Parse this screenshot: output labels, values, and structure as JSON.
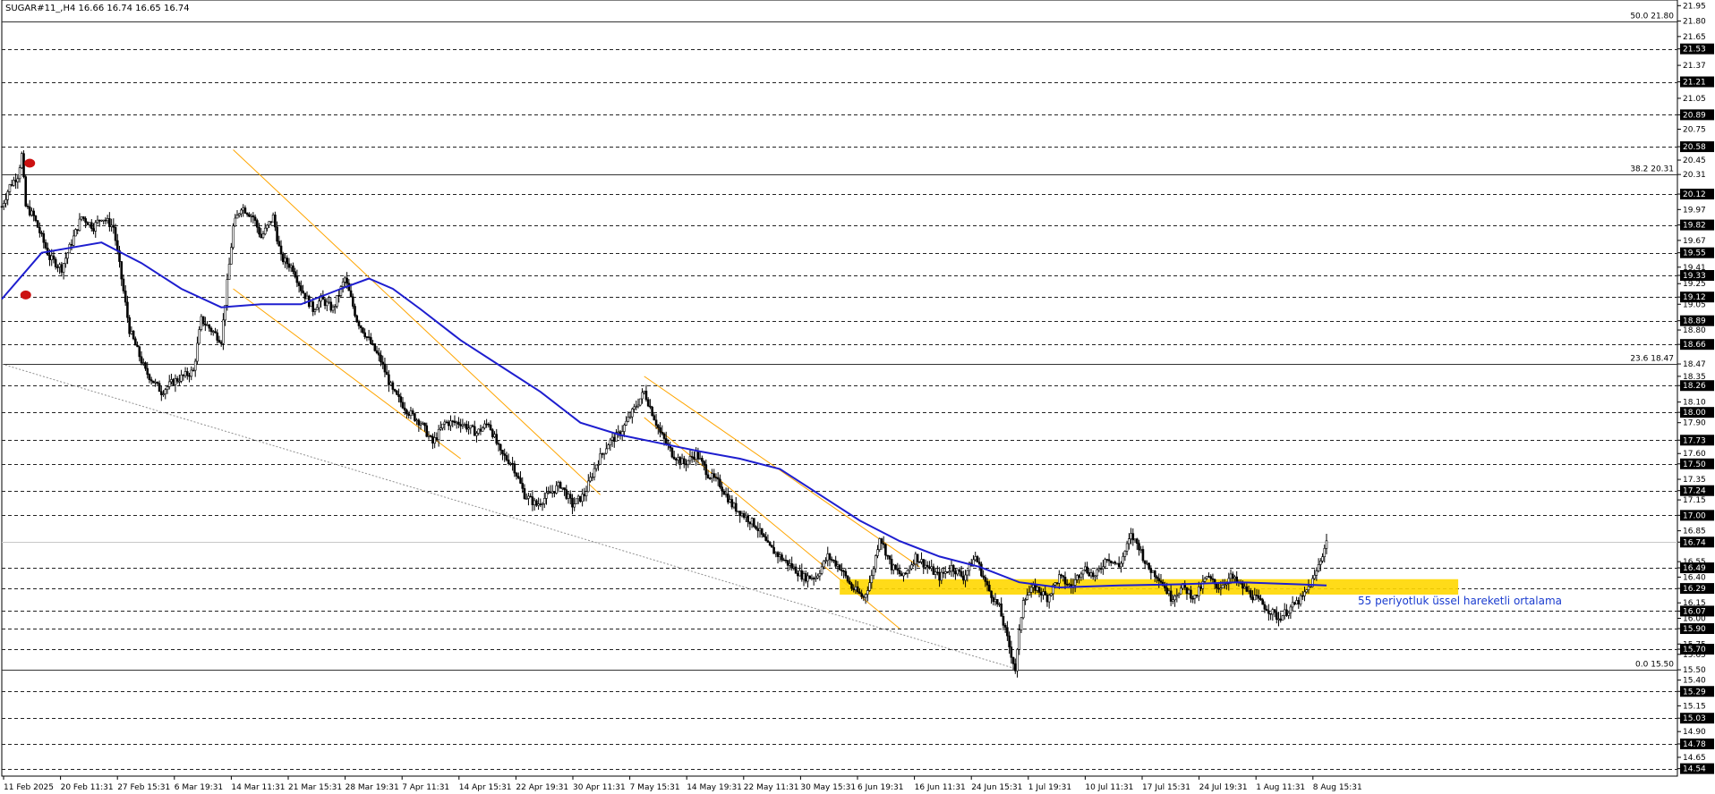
{
  "chart_data": {
    "type": "candlestick",
    "symbol_header": "SUGAR#11_,H4  16.66 16.74 16.65 16.74",
    "ylim": [
      14.45,
      21.97
    ],
    "y_axis_ticks": [
      "21.95",
      "21.80",
      "21.65",
      "21.53",
      "21.37",
      "21.21",
      "21.05",
      "20.89",
      "20.75",
      "20.58",
      "20.45",
      "20.31",
      "20.12",
      "19.97",
      "19.82",
      "19.67",
      "19.55",
      "19.41",
      "19.33",
      "19.25",
      "19.12",
      "19.05",
      "18.89",
      "18.80",
      "18.66",
      "18.47",
      "18.35",
      "18.26",
      "18.10",
      "18.00",
      "17.90",
      "17.73",
      "17.60",
      "17.50",
      "17.35",
      "17.24",
      "17.15",
      "17.00",
      "16.85",
      "16.74",
      "16.55",
      "16.49",
      "16.40",
      "16.29",
      "16.15",
      "16.07",
      "16.00",
      "15.90",
      "15.75",
      "15.70",
      "15.65",
      "15.50",
      "15.40",
      "15.29",
      "15.15",
      "15.03",
      "14.90",
      "14.78",
      "14.65",
      "14.54",
      "14.45"
    ],
    "x_axis_labels": [
      "11 Feb 2025",
      "20 Feb 11:31",
      "27 Feb 15:31",
      "6 Mar 19:31",
      "14 Mar 11:31",
      "21 Mar 15:31",
      "28 Mar 19:31",
      "7 Apr 11:31",
      "14 Apr 15:31",
      "22 Apr 19:31",
      "30 Apr 11:31",
      "7 May 15:31",
      "14 May 19:31",
      "22 May 11:31",
      "30 May 15:31",
      "6 Jun 19:31",
      "16 Jun 11:31",
      "24 Jun 15:31",
      "1 Jul 19:31",
      "10 Jul 11:31",
      "17 Jul 15:31",
      "24 Jul 19:31",
      "1 Aug 11:31",
      "8 Aug 15:31"
    ],
    "dashed_levels": [
      "21.53",
      "21.21",
      "20.89",
      "20.58",
      "20.12",
      "19.82",
      "19.55",
      "19.33",
      "19.12",
      "18.89",
      "18.66",
      "18.26",
      "18.00",
      "17.73",
      "17.50",
      "17.24",
      "17.00",
      "16.49",
      "16.29",
      "16.07",
      "15.90",
      "15.70",
      "15.29",
      "15.03",
      "14.78",
      "14.54"
    ],
    "fibonacci": [
      {
        "label": "50.0 21.80",
        "value": 21.8
      },
      {
        "label": "38.2 20.31",
        "value": 20.31
      },
      {
        "label": "23.6 18.47",
        "value": 18.47
      },
      {
        "label": "0.0 15.50",
        "value": 15.5
      }
    ],
    "current_price": "16.74",
    "annotation": "55 periyotluk üssel hareketli ortalama",
    "close_path": [
      [
        0,
        20.0
      ],
      [
        4,
        20.2
      ],
      [
        8,
        20.3
      ],
      [
        10,
        20.5
      ],
      [
        12,
        20.0
      ],
      [
        16,
        19.9
      ],
      [
        20,
        19.7
      ],
      [
        24,
        19.5
      ],
      [
        30,
        19.4
      ],
      [
        40,
        19.9
      ],
      [
        46,
        19.8
      ],
      [
        50,
        19.9
      ],
      [
        56,
        19.8
      ],
      [
        60,
        19.3
      ],
      [
        64,
        18.8
      ],
      [
        68,
        18.6
      ],
      [
        72,
        18.4
      ],
      [
        80,
        18.2
      ],
      [
        86,
        18.3
      ],
      [
        96,
        18.4
      ],
      [
        100,
        18.9
      ],
      [
        110,
        18.7
      ],
      [
        116,
        19.8
      ],
      [
        120,
        20.0
      ],
      [
        126,
        19.9
      ],
      [
        130,
        19.7
      ],
      [
        136,
        19.9
      ],
      [
        140,
        19.5
      ],
      [
        146,
        19.4
      ],
      [
        150,
        19.2
      ],
      [
        156,
        19.0
      ],
      [
        160,
        19.1
      ],
      [
        166,
        19.0
      ],
      [
        172,
        19.3
      ],
      [
        178,
        18.9
      ],
      [
        184,
        18.7
      ],
      [
        190,
        18.5
      ],
      [
        196,
        18.2
      ],
      [
        204,
        18.0
      ],
      [
        210,
        17.9
      ],
      [
        216,
        17.7
      ],
      [
        222,
        17.9
      ],
      [
        230,
        17.9
      ],
      [
        238,
        17.8
      ],
      [
        244,
        17.9
      ],
      [
        250,
        17.6
      ],
      [
        256,
        17.5
      ],
      [
        262,
        17.2
      ],
      [
        268,
        17.1
      ],
      [
        274,
        17.2
      ],
      [
        280,
        17.3
      ],
      [
        286,
        17.1
      ],
      [
        292,
        17.2
      ],
      [
        298,
        17.5
      ],
      [
        304,
        17.7
      ],
      [
        310,
        17.8
      ],
      [
        316,
        18.0
      ],
      [
        322,
        18.2
      ],
      [
        326,
        18.0
      ],
      [
        330,
        17.8
      ],
      [
        336,
        17.6
      ],
      [
        342,
        17.5
      ],
      [
        348,
        17.6
      ],
      [
        354,
        17.4
      ],
      [
        360,
        17.3
      ],
      [
        366,
        17.1
      ],
      [
        372,
        17.0
      ],
      [
        378,
        16.9
      ],
      [
        384,
        16.7
      ],
      [
        390,
        16.6
      ],
      [
        396,
        16.5
      ],
      [
        402,
        16.4
      ],
      [
        408,
        16.4
      ],
      [
        414,
        16.6
      ],
      [
        420,
        16.5
      ],
      [
        426,
        16.3
      ],
      [
        432,
        16.2
      ],
      [
        436,
        16.4
      ],
      [
        440,
        16.8
      ],
      [
        446,
        16.5
      ],
      [
        452,
        16.4
      ],
      [
        458,
        16.6
      ],
      [
        464,
        16.5
      ],
      [
        470,
        16.4
      ],
      [
        476,
        16.5
      ],
      [
        482,
        16.4
      ],
      [
        488,
        16.6
      ],
      [
        494,
        16.3
      ],
      [
        500,
        16.1
      ],
      [
        504,
        15.8
      ],
      [
        508,
        15.5
      ],
      [
        512,
        16.2
      ],
      [
        518,
        16.3
      ],
      [
        524,
        16.2
      ],
      [
        530,
        16.4
      ],
      [
        536,
        16.3
      ],
      [
        542,
        16.5
      ],
      [
        548,
        16.4
      ],
      [
        554,
        16.6
      ],
      [
        560,
        16.5
      ],
      [
        566,
        16.8
      ],
      [
        570,
        16.7
      ],
      [
        574,
        16.5
      ],
      [
        580,
        16.4
      ],
      [
        586,
        16.2
      ],
      [
        592,
        16.3
      ],
      [
        598,
        16.2
      ],
      [
        604,
        16.4
      ],
      [
        610,
        16.3
      ],
      [
        616,
        16.4
      ],
      [
        622,
        16.3
      ],
      [
        628,
        16.2
      ],
      [
        634,
        16.1
      ],
      [
        640,
        16.0
      ],
      [
        646,
        16.1
      ],
      [
        652,
        16.2
      ],
      [
        658,
        16.4
      ],
      [
        664,
        16.74
      ]
    ],
    "ema55_path": [
      [
        0,
        19.1
      ],
      [
        20,
        19.55
      ],
      [
        50,
        19.65
      ],
      [
        70,
        19.45
      ],
      [
        90,
        19.2
      ],
      [
        110,
        19.02
      ],
      [
        130,
        19.05
      ],
      [
        150,
        19.05
      ],
      [
        170,
        19.2
      ],
      [
        184,
        19.3
      ],
      [
        196,
        19.2
      ],
      [
        210,
        19.0
      ],
      [
        230,
        18.7
      ],
      [
        250,
        18.45
      ],
      [
        270,
        18.2
      ],
      [
        290,
        17.9
      ],
      [
        310,
        17.78
      ],
      [
        330,
        17.7
      ],
      [
        350,
        17.62
      ],
      [
        370,
        17.55
      ],
      [
        390,
        17.45
      ],
      [
        410,
        17.2
      ],
      [
        430,
        16.95
      ],
      [
        450,
        16.75
      ],
      [
        470,
        16.6
      ],
      [
        490,
        16.5
      ],
      [
        510,
        16.35
      ],
      [
        530,
        16.3
      ],
      [
        560,
        16.32
      ],
      [
        590,
        16.33
      ],
      [
        620,
        16.35
      ],
      [
        650,
        16.33
      ],
      [
        664,
        16.32
      ]
    ],
    "channels": [
      {
        "start": [
          116,
          20.55
        ],
        "end": [
          300,
          17.2
        ],
        "color": "#ffa500"
      },
      {
        "start": [
          116,
          19.2
        ],
        "end": [
          230,
          17.55
        ],
        "color": "#ffa500"
      },
      {
        "start": [
          322,
          18.35
        ],
        "end": [
          460,
          16.5
        ],
        "color": "#ffa500"
      },
      {
        "start": [
          322,
          17.95
        ],
        "end": [
          450,
          15.9
        ],
        "color": "#ffa500"
      }
    ],
    "trendline": {
      "start": [
        0,
        18.47
      ],
      "end": [
        510,
        15.5
      ],
      "color": "#909090"
    },
    "support_zone": {
      "from": 16.23,
      "to": 16.38,
      "x_start": 420,
      "x_end": 730,
      "color": "#ffd700"
    },
    "markers": [
      {
        "at": [
          14,
          20.42
        ],
        "color": "#cc1111"
      },
      {
        "at": [
          12,
          19.14
        ],
        "color": "#cc1111"
      }
    ]
  }
}
